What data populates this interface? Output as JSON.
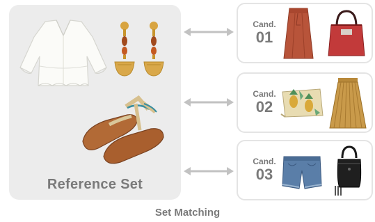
{
  "reference": {
    "title": "Reference Set",
    "items": [
      {
        "name": "white-blouse-image"
      },
      {
        "name": "earrings-image"
      },
      {
        "name": "sandals-image"
      }
    ]
  },
  "candidates": [
    {
      "word": "Cand.",
      "number": "01",
      "items": [
        "rust-skirt-image",
        "red-tote-bag-image"
      ]
    },
    {
      "word": "Cand.",
      "number": "02",
      "items": [
        "pineapple-clutch-image",
        "mustard-pleated-skirt-image"
      ]
    },
    {
      "word": "Cand.",
      "number": "03",
      "items": [
        "denim-shorts-image",
        "black-backpack-image"
      ]
    }
  ],
  "footer": "Set Matching",
  "colors": {
    "panel": "#ececec",
    "label": "#7a7a7a",
    "arrow": "#c2c2c2",
    "card_border": "#e4e4e4"
  }
}
